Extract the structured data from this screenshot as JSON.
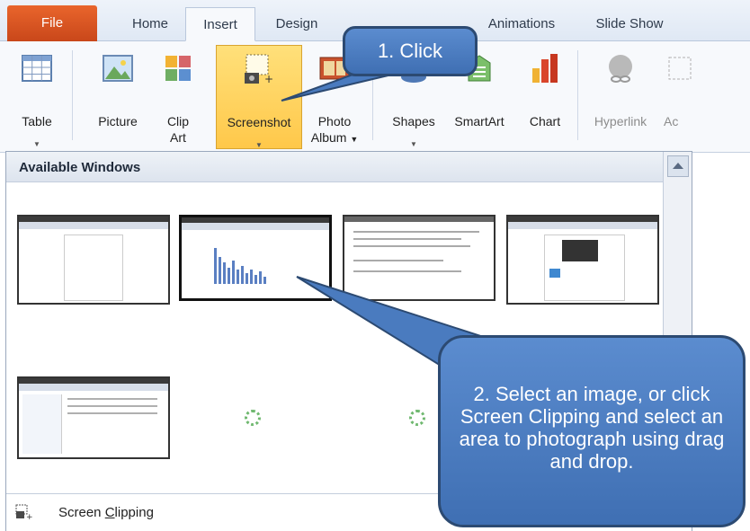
{
  "tabs": [
    {
      "label": "File"
    },
    {
      "label": "Home"
    },
    {
      "label": "Insert"
    },
    {
      "label": "Design"
    },
    {
      "label": "Animations"
    },
    {
      "label": "Slide Show"
    }
  ],
  "ribbon": {
    "table": {
      "label": "Table",
      "icon": "table-icon"
    },
    "picture": {
      "label": "Picture",
      "icon": "picture-icon"
    },
    "clipart": {
      "label": "Clip Art",
      "line1": "Clip",
      "line2": "Art",
      "icon": "clip-art-icon"
    },
    "screenshot": {
      "label": "Screenshot",
      "icon": "screenshot-icon"
    },
    "photo_album": {
      "line1": "Photo",
      "line2": "Album",
      "icon": "photo-album-icon"
    },
    "shapes": {
      "label": "Shapes",
      "icon": "shapes-icon"
    },
    "smartart": {
      "label": "SmartArt",
      "icon": "smartart-icon"
    },
    "chart": {
      "label": "Chart",
      "icon": "chart-icon"
    },
    "hyperlink": {
      "label": "Hyperlink",
      "icon": "hyperlink-icon"
    },
    "action": {
      "label": "Ac",
      "icon": "action-icon"
    }
  },
  "panel": {
    "title": "Available Windows",
    "screen_clipping": {
      "prefix": "Screen ",
      "underlined": "C",
      "suffix": "lipping"
    }
  },
  "callouts": {
    "one": "1. Click",
    "two": "2. Select an image, or click Screen Clipping and select an area to photograph using drag and drop."
  },
  "colors": {
    "file_tab": "#d9541f",
    "callout_fill": "#4f7fc2",
    "callout_border": "#2c4a72",
    "highlight": "#ffcf5a"
  }
}
